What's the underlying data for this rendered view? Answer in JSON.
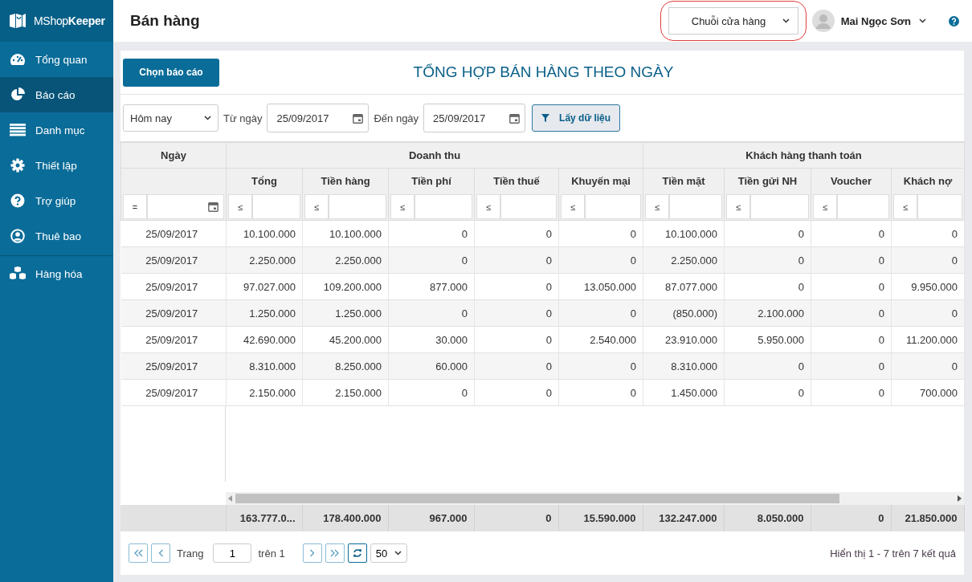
{
  "sidebar": {
    "logo": {
      "plain": "MShop",
      "bold": "Keeper"
    },
    "items": [
      {
        "label": "Tổng quan",
        "selected": false
      },
      {
        "label": "Báo cáo",
        "selected": true
      },
      {
        "label": "Danh mục",
        "selected": false
      },
      {
        "label": "Thiết lập",
        "selected": false
      },
      {
        "label": "Trợ giúp",
        "selected": false
      },
      {
        "label": "Thuê bao",
        "selected": false
      },
      {
        "label": "Hàng hóa",
        "selected": false
      }
    ]
  },
  "header": {
    "title": "Bán hàng",
    "store_selector": {
      "label": "Chuỗi cửa hàng",
      "highlighted": true
    },
    "user": {
      "name": "Mai Ngọc Sơn"
    }
  },
  "report": {
    "choose_button": "Chọn báo cáo",
    "title": "TỔNG HỢP BÁN HÀNG THEO NGÀY"
  },
  "filters": {
    "period": "Hôm nay",
    "from_label": "Từ ngày",
    "from": "25/09/2017",
    "to_label": "Đến ngày",
    "to": "25/09/2017",
    "fetch_button": "Lấy dữ liệu"
  },
  "table": {
    "date_column": {
      "label": "Ngày",
      "filter_operator": "="
    },
    "column_groups": [
      {
        "label": "Doanh thu",
        "columns": [
          {
            "label": "Tổng",
            "filter_operator": "≤"
          },
          {
            "label": "Tiền hàng",
            "filter_operator": "≤"
          },
          {
            "label": "Tiền phí",
            "filter_operator": "≤"
          },
          {
            "label": "Tiền thuế",
            "filter_operator": "≤"
          },
          {
            "label": "Khuyến mại",
            "filter_operator": "≤"
          }
        ]
      },
      {
        "label": "Khách hàng thanh toán",
        "columns": [
          {
            "label": "Tiền mặt",
            "filter_operator": "≤"
          },
          {
            "label": "Tiền gửi NH",
            "filter_operator": "≤"
          },
          {
            "label": "Voucher",
            "filter_operator": "≤"
          },
          {
            "label": "Khách nợ",
            "filter_operator": "≤"
          }
        ]
      }
    ],
    "rows": [
      [
        "25/09/2017",
        "10.100.000",
        "10.100.000",
        "0",
        "0",
        "0",
        "10.100.000",
        "0",
        "0",
        "0"
      ],
      [
        "25/09/2017",
        "2.250.000",
        "2.250.000",
        "0",
        "0",
        "0",
        "2.250.000",
        "0",
        "0",
        "0"
      ],
      [
        "25/09/2017",
        "97.027.000",
        "109.200.000",
        "877.000",
        "0",
        "13.050.000",
        "87.077.000",
        "0",
        "0",
        "9.950.000"
      ],
      [
        "25/09/2017",
        "1.250.000",
        "1.250.000",
        "0",
        "0",
        "0",
        "(850.000)",
        "2.100.000",
        "0",
        "0"
      ],
      [
        "25/09/2017",
        "42.690.000",
        "45.200.000",
        "30.000",
        "0",
        "2.540.000",
        "23.910.000",
        "5.950.000",
        "0",
        "11.200.000"
      ],
      [
        "25/09/2017",
        "8.310.000",
        "8.250.000",
        "60.000",
        "0",
        "0",
        "8.310.000",
        "0",
        "0",
        "0"
      ],
      [
        "25/09/2017",
        "2.150.000",
        "2.150.000",
        "0",
        "0",
        "0",
        "1.450.000",
        "0",
        "0",
        "700.000"
      ]
    ],
    "totals": [
      "163.777.0...",
      "178.400.000",
      "967.000",
      "0",
      "15.590.000",
      "132.247.000",
      "8.050.000",
      "0",
      "21.850.000"
    ]
  },
  "pager": {
    "page_label": "Trang",
    "page": "1",
    "of": "trên 1",
    "page_size": "50",
    "summary": "Hiển thị 1 - 7 trên 7 kết quả"
  }
}
